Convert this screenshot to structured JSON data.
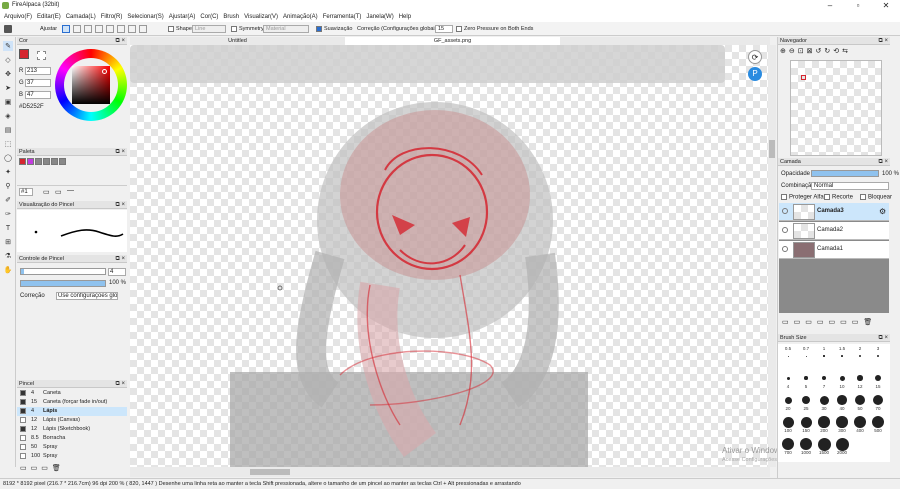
{
  "title": "FireAlpaca (32bit)",
  "menu": [
    "Arquivo(F)",
    "Editar(E)",
    "Camada(L)",
    "Filtro(R)",
    "Selecionar(S)",
    "Ajustar(A)",
    "Cor(C)",
    "Brush",
    "Visualizar(V)",
    "Animação(A)",
    "Ferramenta(T)",
    "Janela(W)",
    "Help"
  ],
  "toolbar": {
    "ajustar": "Ajustar",
    "shape": "Shape",
    "shape_value": "Line",
    "symmetry": "Symmetry",
    "symmetry_value": "Material",
    "suavizacao": "Suavização",
    "correcao": "Correção (Configurações globais)",
    "correcao_value": "15",
    "zero_pressure": "Zero Pressure on Both Ends"
  },
  "tabs": [
    "Untitled",
    "GF_assets.png"
  ],
  "cor": {
    "title": "Cor",
    "r_label": "R",
    "r": "213",
    "g_label": "G",
    "g": "37",
    "b_label": "B",
    "b": "47",
    "hex": "#D5252F",
    "color": "#D5252F"
  },
  "paleta": {
    "title": "Paleta",
    "colors": [
      "#d5252f",
      "#c33be0",
      "#888888",
      "#888888",
      "#888888",
      "#888888"
    ]
  },
  "layer_select": "#1",
  "brush_preview": {
    "title": "Visualização do Pincel"
  },
  "brush_control": {
    "title": "Controle de Pincel",
    "size": "4",
    "opacity": "100 %",
    "correcao_label": "Correção",
    "correcao_value": "Use configurações globais"
  },
  "pincel": {
    "title": "Pincel",
    "items": [
      {
        "size": "4",
        "name": "Caneta",
        "color": "#333333"
      },
      {
        "size": "15",
        "name": "Caneta (forçar fade in/out)",
        "color": "#333333"
      },
      {
        "size": "4",
        "name": "Lápis",
        "color": "#333333",
        "selected": true
      },
      {
        "size": "12",
        "name": "Lápis (Canvas)",
        "color": "#ffffff"
      },
      {
        "size": "12",
        "name": "Lápis (Sketchbook)",
        "color": "#333333"
      },
      {
        "size": "8.5",
        "name": "Borracha",
        "color": "#ffffff"
      },
      {
        "size": "50",
        "name": "Spray",
        "color": "#ffffff"
      },
      {
        "size": "100",
        "name": "Spray",
        "color": "#ffffff"
      }
    ]
  },
  "navegador": {
    "title": "Navegador"
  },
  "camada": {
    "title": "Camada",
    "opacidade_label": "Opacidade",
    "opacidade": "100 %",
    "combinacao_label": "Combinação",
    "combinacao": "Normal",
    "proteger_alfa": "Proteger Alfa",
    "recorte": "Recorte",
    "bloquear": "Bloquear",
    "layers": [
      "Camada3",
      "Camada2",
      "Camada1"
    ]
  },
  "brush_size": {
    "title": "Brush Size",
    "labels": [
      "0.5",
      "0.7",
      "1",
      "1.5",
      "2",
      "3",
      "4",
      "5",
      "7",
      "10",
      "12",
      "15",
      "20",
      "25",
      "30",
      "40",
      "50",
      "70",
      "100",
      "150",
      "200",
      "300",
      "400",
      "500",
      "700",
      "1000",
      "1500",
      "2000"
    ]
  },
  "status": "8192 * 8192 pixel   (216.7 * 216.7cm)   96 dpi   200 %   ( 820, 1447 )   Desenhe uma linha reta ao manter a tecla Shift pressionada, altere o tamanho de um pincel ao manter as teclas Ctrl + Alt pressionadas e arrastando",
  "watermark": {
    "line1": "Ativar o Windows",
    "line2": "Acesse Configurações para ativar o Windows."
  }
}
